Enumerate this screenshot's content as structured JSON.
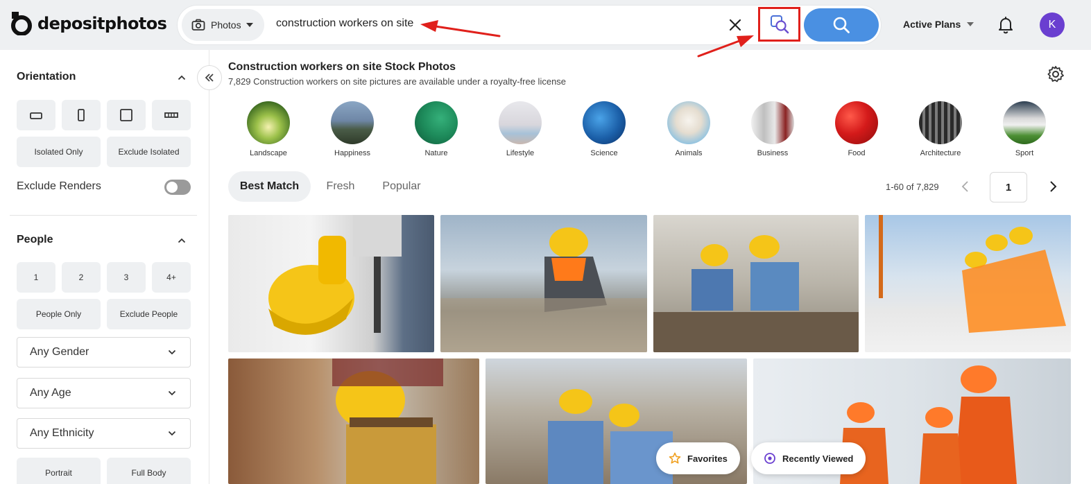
{
  "header": {
    "logo_text": "depositphotos",
    "search_type": "Photos",
    "search_query": "construction workers on site",
    "active_plans": "Active Plans",
    "avatar_letter": "K"
  },
  "sidebar": {
    "orientation": {
      "title": "Orientation",
      "isolated_only": "Isolated Only",
      "exclude_isolated": "Exclude Isolated",
      "exclude_renders": "Exclude Renders",
      "exclude_renders_on": false
    },
    "people": {
      "title": "People",
      "counts": [
        "1",
        "2",
        "3",
        "4+"
      ],
      "people_only": "People Only",
      "exclude_people": "Exclude People",
      "gender": "Any Gender",
      "age": "Any Age",
      "ethnicity": "Any Ethnicity",
      "portrait": "Portrait",
      "full_body": "Full Body"
    }
  },
  "main": {
    "title": "Construction workers on site Stock Photos",
    "subtitle": "7,829 Construction workers on site pictures are available under a royalty-free license",
    "categories": [
      "Landscape",
      "Happiness",
      "Nature",
      "Lifestyle",
      "Science",
      "Animals",
      "Business",
      "Food",
      "Architecture",
      "Sport"
    ],
    "tabs": [
      "Best Match",
      "Fresh",
      "Popular"
    ],
    "active_tab": "Best Match",
    "results_range": "1-60 of 7,829",
    "page": "1"
  },
  "floating": {
    "favorites": "Favorites",
    "recently_viewed": "Recently Viewed"
  },
  "colors": {
    "accent": "#4a90e2",
    "highlight": "#e0201b",
    "avatar": "#6a3fd0",
    "hardhat": "#f5c518"
  }
}
